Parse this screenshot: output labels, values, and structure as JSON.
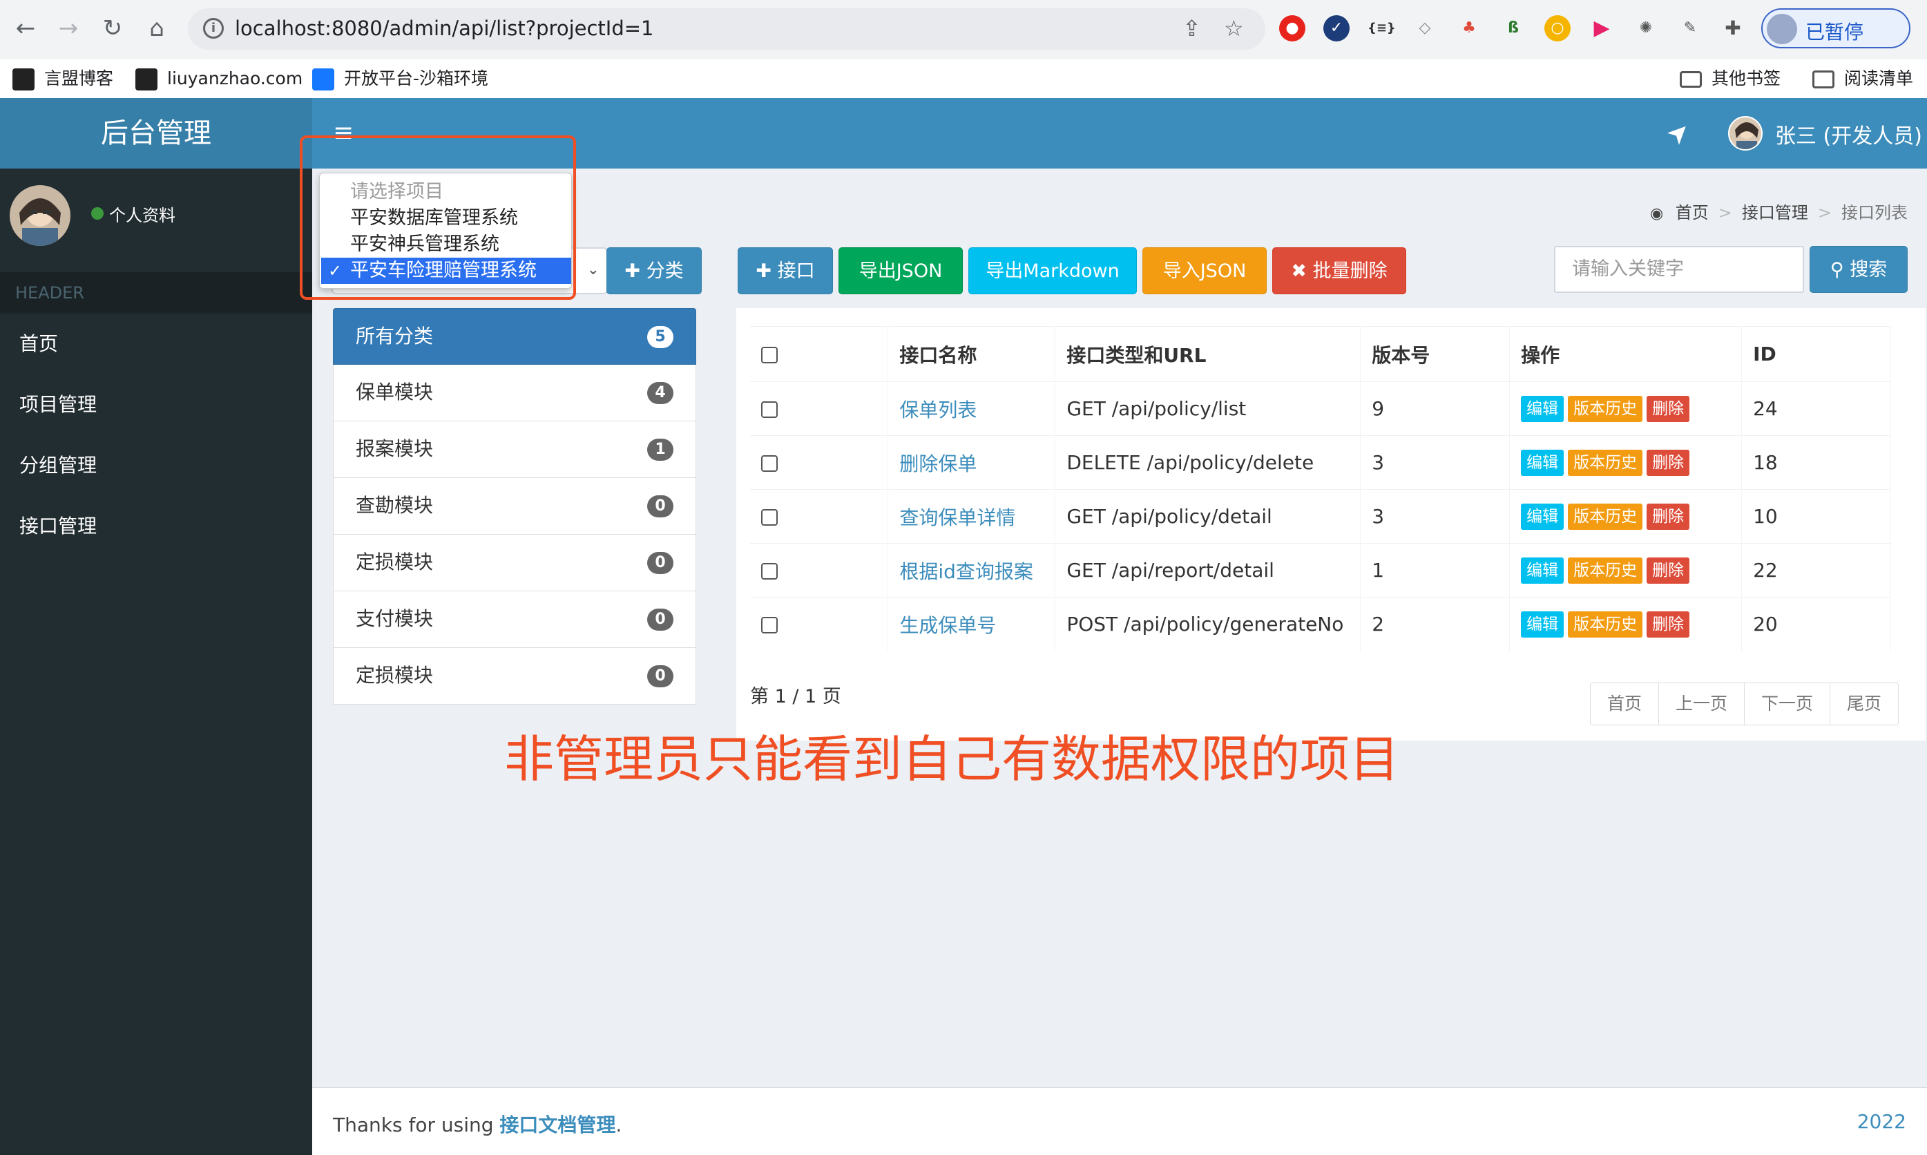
{
  "browser": {
    "url": "localhost:8080/admin/api/list?projectId=1",
    "profile_label": "已暂停",
    "bookmarks": [
      "言盟博客",
      "liuyanzhao.com",
      "开放平台-沙箱环境"
    ],
    "bookmarks_right": [
      "其他书签",
      "阅读清单"
    ]
  },
  "header": {
    "logo": "后台管理",
    "menu_icon": "≡",
    "user_name": "张三 (开发人员)"
  },
  "sidebar": {
    "profile_label": "个人资料",
    "section_header": "HEADER",
    "items": [
      {
        "label": "首页"
      },
      {
        "label": "项目管理"
      },
      {
        "label": "分组管理"
      },
      {
        "label": "接口管理"
      }
    ]
  },
  "breadcrumb": {
    "home": "首页",
    "level1": "接口管理",
    "level2": "接口列表"
  },
  "project_dropdown": {
    "options": [
      {
        "label": "请选择项目",
        "state": "disabled"
      },
      {
        "label": "平安数据库管理系统",
        "state": "normal"
      },
      {
        "label": "平安神兵管理系统",
        "state": "normal"
      },
      {
        "label": "平安车险理赔管理系统",
        "state": "selected"
      }
    ],
    "check_mark": "✓"
  },
  "toolbar": {
    "category_button": "分类",
    "add_api_button": "接口",
    "export_json": "导出JSON",
    "export_markdown": "导出Markdown",
    "import_json": "导入JSON",
    "batch_delete": "批量删除",
    "search_placeholder": "请输入关键字",
    "search_button": "搜索"
  },
  "categories": [
    {
      "label": "所有分类",
      "count": "5"
    },
    {
      "label": "保单模块",
      "count": "4"
    },
    {
      "label": "报案模块",
      "count": "1"
    },
    {
      "label": "查勘模块",
      "count": "0"
    },
    {
      "label": "定损模块",
      "count": "0"
    },
    {
      "label": "支付模块",
      "count": "0"
    },
    {
      "label": "定损模块",
      "count": "0"
    }
  ],
  "table": {
    "headers": [
      "",
      "接口名称",
      "接口类型和URL",
      "版本号",
      "操作",
      "ID"
    ],
    "actions": {
      "edit": "编辑",
      "history": "版本历史",
      "delete": "删除"
    },
    "rows": [
      {
        "name": "保单列表",
        "method_url": "GET  /api/policy/list",
        "version": "9",
        "id": "24"
      },
      {
        "name": "删除保单",
        "method_url": "DELETE  /api/policy/delete",
        "version": "3",
        "id": "18"
      },
      {
        "name": "查询保单详情",
        "method_url": "GET  /api/policy/detail",
        "version": "3",
        "id": "10"
      },
      {
        "name": "根据id查询报案",
        "method_url": "GET  /api/report/detail",
        "version": "1",
        "id": "22"
      },
      {
        "name": "生成保单号",
        "method_url": "POST  /api/policy/generateNo",
        "version": "2",
        "id": "20"
      }
    ]
  },
  "pagination": {
    "info": "第 1 / 1 页",
    "first": "首页",
    "prev": "上一页",
    "next": "下一页",
    "last": "尾页"
  },
  "annotation": "非管理员只能看到自己有数据权限的项目",
  "footer": {
    "prefix": "Thanks for using ",
    "link": "接口文档管理",
    "suffix": ".",
    "year": "2022"
  },
  "colors": {
    "primary": "#3c8dbc",
    "sidebar": "#222d32",
    "annotation": "#f04e23",
    "selected_option": "#2a6ff0"
  }
}
